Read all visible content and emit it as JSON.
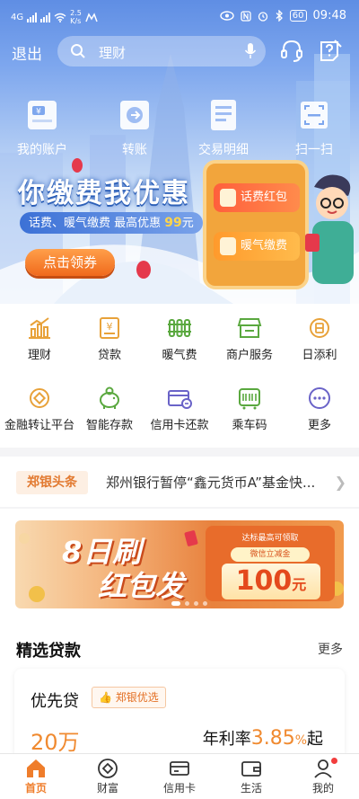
{
  "status_bar": {
    "network": "4G",
    "speed_value": "2.5",
    "speed_unit": "K/s",
    "battery": "60",
    "time": "09:48"
  },
  "header": {
    "exit_label": "退出",
    "search_placeholder": "理财"
  },
  "quick_actions": [
    {
      "label": "我的账户",
      "icon": "account-card-icon"
    },
    {
      "label": "转账",
      "icon": "transfer-icon"
    },
    {
      "label": "交易明细",
      "icon": "transaction-details-icon"
    },
    {
      "label": "扫一扫",
      "icon": "scan-icon"
    }
  ],
  "hero_promo": {
    "title": "你缴费我优惠",
    "subtitle_prefix": "话费、暖气缴费 最高优惠",
    "subtitle_amount": "99",
    "subtitle_unit": "元",
    "button": "点击领券",
    "card1": "话费红包",
    "card2": "暖气缴费"
  },
  "services": [
    {
      "label": "理财",
      "icon": "chart-icon"
    },
    {
      "label": "贷款",
      "icon": "loan-doc-icon"
    },
    {
      "label": "暖气费",
      "icon": "radiator-icon"
    },
    {
      "label": "商户服务",
      "icon": "shop-icon"
    },
    {
      "label": "日添利",
      "icon": "coin-icon"
    },
    {
      "label": "金融转让平台",
      "icon": "transfer-platform-icon"
    },
    {
      "label": "智能存款",
      "icon": "piggy-bank-icon"
    },
    {
      "label": "信用卡还款",
      "icon": "credit-card-icon"
    },
    {
      "label": "乘车码",
      "icon": "bus-code-icon"
    },
    {
      "label": "更多",
      "icon": "more-icon"
    }
  ],
  "news": {
    "tag": "郑银头条",
    "headline": "郑州银行暂停“鑫元货币A”基金快..."
  },
  "banner": {
    "line1": "8日刷",
    "line2": "红包发",
    "caption": "达标最高可领取",
    "tag": "微信立减金",
    "amount": "100",
    "unit": "元",
    "active_slide": 1,
    "slide_count": 4
  },
  "loans": {
    "title": "精选贷款",
    "more": "更多",
    "card": {
      "name": "优先贷",
      "badge": "郑银优选",
      "amount": "20万",
      "rate_label": "年利率",
      "rate_value": "3.85",
      "rate_percent": "%",
      "rate_suffix": "起"
    }
  },
  "tabbar": [
    {
      "label": "首页",
      "icon": "home-icon",
      "active": true
    },
    {
      "label": "财富",
      "icon": "wealth-icon",
      "active": false
    },
    {
      "label": "信用卡",
      "icon": "credit-card-tab-icon",
      "active": false
    },
    {
      "label": "生活",
      "icon": "wallet-icon",
      "active": false
    },
    {
      "label": "我的",
      "icon": "profile-icon",
      "active": false
    }
  ],
  "colors": {
    "accent": "#ef7d2b",
    "hero_blue": "#5f8ee4",
    "icon_gold": "#e8a23a",
    "icon_green": "#5aa83f",
    "icon_purple": "#6a63c8"
  }
}
